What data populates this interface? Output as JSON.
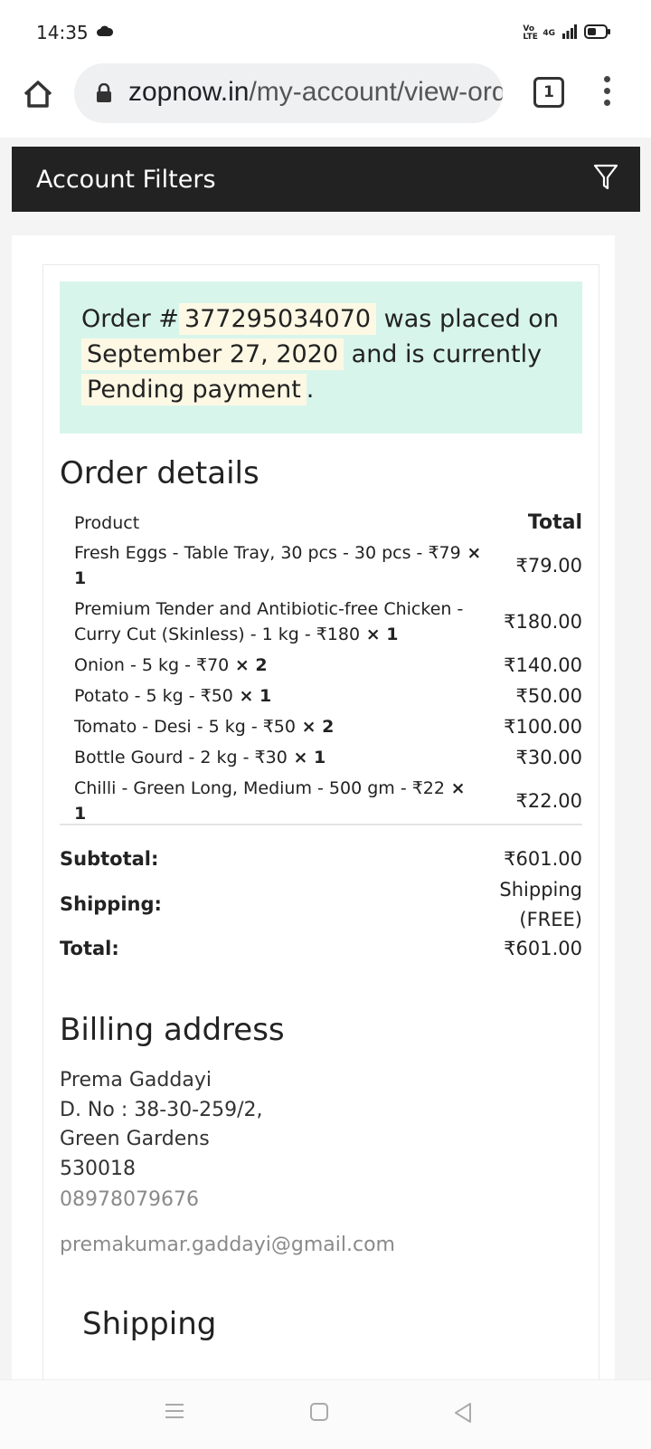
{
  "status_bar": {
    "time": "14:35",
    "network_label": "4G",
    "volte_label": "Vo LTE",
    "icons": [
      "cloud-icon",
      "volte-icon",
      "signal-icon",
      "battery-icon"
    ]
  },
  "browser": {
    "url_host": "zopnow.in",
    "url_path": "/my-account/view-order/",
    "tab_count": "1",
    "icons": [
      "home-icon",
      "lock-icon",
      "tabs-icon",
      "more-vert-icon"
    ]
  },
  "filters_bar": {
    "label": "Account Filters",
    "icon": "filter-icon"
  },
  "order_notice": {
    "prefix": "Order #",
    "order_number": "377295034070",
    "mid1": " was placed on ",
    "date": "September 27, 2020",
    "mid2": " and is currently ",
    "status": "Pending payment",
    "suffix": "."
  },
  "order_details": {
    "title": "Order details",
    "col_product": "Product",
    "col_total": "Total",
    "items": [
      {
        "name": "Fresh Eggs - Table Tray, 30 pcs - 30 pcs - ₹79",
        "qty": " × 1",
        "total": "₹79.00"
      },
      {
        "name": "Premium Tender and Antibiotic-free Chicken - Curry Cut (Skinless) - 1 kg - ₹180",
        "qty": " × 1",
        "total": "₹180.00"
      },
      {
        "name": "Onion - 5 kg - ₹70",
        "qty": " × 2",
        "total": "₹140.00"
      },
      {
        "name": "Potato - 5 kg - ₹50",
        "qty": " × 1",
        "total": "₹50.00"
      },
      {
        "name": "Tomato - Desi - 5 kg - ₹50",
        "qty": " × 2",
        "total": "₹100.00"
      },
      {
        "name": "Bottle Gourd - 2 kg - ₹30",
        "qty": " × 1",
        "total": "₹30.00"
      },
      {
        "name": "Chilli - Green Long, Medium - 500 gm - ₹22",
        "qty": " × 1",
        "total": "₹22.00"
      }
    ],
    "subtotal_label": "Subtotal:",
    "subtotal_value": "₹601.00",
    "shipping_label": "Shipping:",
    "shipping_value_line1": "Shipping",
    "shipping_value_line2": "(FREE)",
    "total_label": "Total:",
    "total_value": "₹601.00"
  },
  "billing_address": {
    "title": "Billing address",
    "name": "Prema Gaddayi",
    "line1": "D. No : 38-30-259/2,",
    "line2": "Green Gardens",
    "postcode": "530018",
    "phone": "08978079676",
    "email": "premakumar.gaddayi@gmail.com"
  },
  "shipping_section": {
    "title": "Shipping"
  },
  "nav_bar": {
    "icons": [
      "recents-menu-icon",
      "home-square-icon",
      "back-triangle-icon"
    ]
  }
}
